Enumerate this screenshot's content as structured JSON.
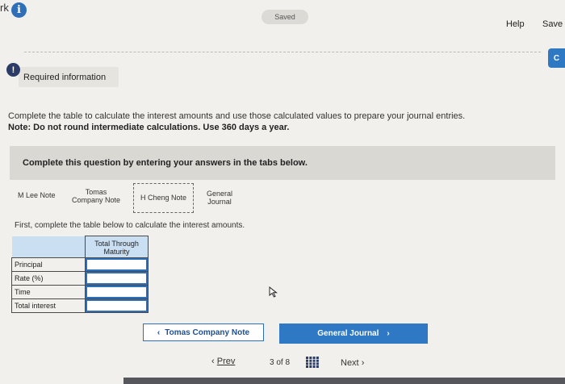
{
  "topbar": {
    "partial_title": "rk",
    "saved_label": "Saved",
    "help_label": "Help",
    "save_label": "Save",
    "side_tab_label": "C"
  },
  "required": {
    "alert_glyph": "!",
    "label": "Required information"
  },
  "instructions": {
    "line1": "Complete the table to calculate the interest amounts and use those calculated values to prepare your journal entries.",
    "line2": "Note: Do not round intermediate calculations. Use 360 days a year."
  },
  "question": {
    "header": "Complete this question by entering your answers in the tabs below."
  },
  "tabs": [
    {
      "label": "M Lee Note"
    },
    {
      "label_line1": "Tomas",
      "label_line2": "Company Note"
    },
    {
      "label": "H Cheng Note"
    },
    {
      "label_line1": "General",
      "label_line2": "Journal"
    }
  ],
  "panel": {
    "intro": "First, complete the table below to calculate the interest amounts.",
    "table": {
      "column_header_line1": "Total Through",
      "column_header_line2": "Maturity",
      "rows": [
        {
          "label": "Principal",
          "value": ""
        },
        {
          "label": "Rate (%)",
          "value": ""
        },
        {
          "label": "Time",
          "value": ""
        },
        {
          "label": "Total interest",
          "value": ""
        }
      ]
    }
  },
  "nav": {
    "prev_tab_label": "Tomas Company Note",
    "next_tab_label": "General Journal",
    "prev_label": "Prev",
    "page_current": "3",
    "page_of": "of",
    "page_total": "8",
    "next_label": "Next"
  },
  "colors": {
    "accent": "#2f79c4",
    "table_header": "#cbdff3",
    "question_bar": "#dad8d3"
  }
}
